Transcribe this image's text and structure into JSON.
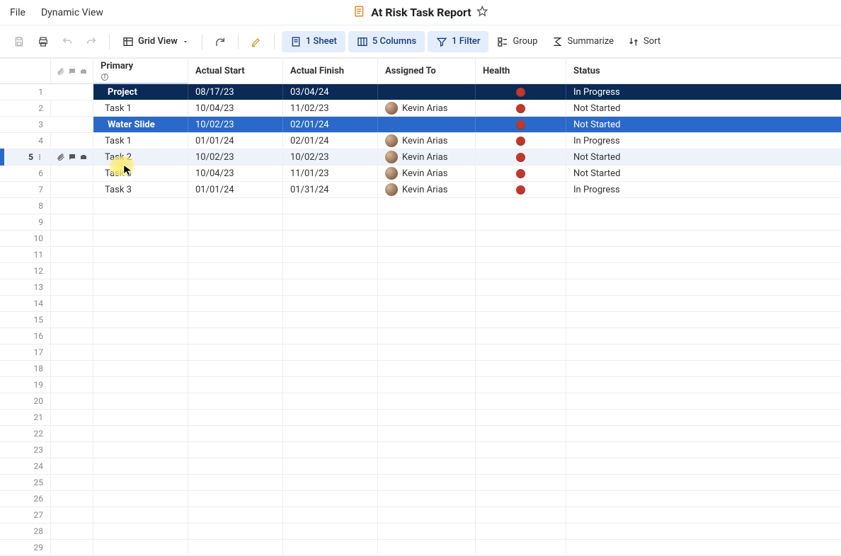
{
  "menu": {
    "file": "File",
    "dynamic_view": "Dynamic View"
  },
  "title": "At Risk Task Report",
  "toolbar": {
    "grid_view": "Grid View",
    "sheet": "1 Sheet",
    "columns": "5 Columns",
    "filter": "1 Filter",
    "group": "Group",
    "summarize": "Summarize",
    "sort": "Sort"
  },
  "headers": {
    "primary": "Primary",
    "actual_start": "Actual Start",
    "actual_finish": "Actual Finish",
    "assigned": "Assigned To",
    "health": "Health",
    "status": "Status"
  },
  "assignee_name": "Kevin Arias",
  "rows": [
    {
      "n": 1,
      "type": "parent-dark",
      "primary": "Project",
      "start": "08/17/23",
      "finish": "03/04/24",
      "assigned": "",
      "health": "red",
      "status": "In Progress"
    },
    {
      "n": 2,
      "type": "child",
      "primary": "Task 1",
      "start": "10/04/23",
      "finish": "11/02/23",
      "assigned": "Kevin Arias",
      "health": "red",
      "status": "Not Started"
    },
    {
      "n": 3,
      "type": "parent-blue",
      "primary": "Water Slide",
      "start": "10/02/23",
      "finish": "02/01/24",
      "assigned": "",
      "health": "red",
      "status": "Not Started"
    },
    {
      "n": 4,
      "type": "child",
      "primary": "Task 1",
      "start": "01/01/24",
      "finish": "02/01/24",
      "assigned": "Kevin Arias",
      "health": "red",
      "status": "In Progress"
    },
    {
      "n": 5,
      "type": "active",
      "primary": "Task 2",
      "start": "10/02/23",
      "finish": "10/02/23",
      "assigned": "Kevin Arias",
      "health": "red",
      "status": "Not Started"
    },
    {
      "n": 6,
      "type": "child",
      "primary": "Task 3",
      "start": "10/04/23",
      "finish": "11/01/23",
      "assigned": "Kevin Arias",
      "health": "red",
      "status": "Not Started"
    },
    {
      "n": 7,
      "type": "child",
      "primary": "Task 3",
      "start": "01/01/24",
      "finish": "01/31/24",
      "assigned": "Kevin Arias",
      "health": "red",
      "status": "In Progress"
    }
  ],
  "empty_rows_start": 8,
  "empty_rows_end": 29
}
